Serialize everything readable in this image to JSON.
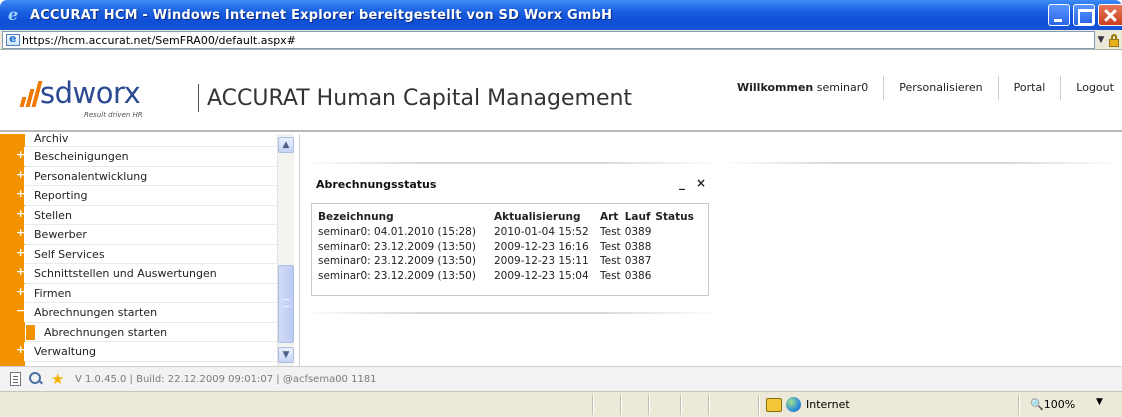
{
  "window": {
    "title": "ACCURAT HCM - Windows Internet Explorer bereitgestellt von SD Worx GmbH"
  },
  "address": {
    "url": "https://hcm.accurat.net/SemFRA00/default.aspx#"
  },
  "header": {
    "logo_word": "sdworx",
    "logo_tagline": "Result driven HR",
    "app_title": "ACCURAT Human Capital Management",
    "welcome_label": "Willkommen",
    "welcome_user": "seminar0",
    "nav": [
      "Personalisieren",
      "Portal",
      "Logout"
    ]
  },
  "sidebar": {
    "items": [
      {
        "label": "Archiv",
        "toggle": "+"
      },
      {
        "label": "Bescheinigungen",
        "toggle": "+"
      },
      {
        "label": "Personalentwicklung",
        "toggle": "+"
      },
      {
        "label": "Reporting",
        "toggle": "+"
      },
      {
        "label": "Stellen",
        "toggle": "+"
      },
      {
        "label": "Bewerber",
        "toggle": "+"
      },
      {
        "label": "Self Services",
        "toggle": "+"
      },
      {
        "label": "Schnittstellen und Auswertungen",
        "toggle": "+"
      },
      {
        "label": "Firmen",
        "toggle": "+"
      },
      {
        "label": "Abrechnungen starten",
        "toggle": "−"
      },
      {
        "label": "Abrechnungen starten",
        "toggle": ""
      },
      {
        "label": "Verwaltung",
        "toggle": "+"
      }
    ]
  },
  "widget": {
    "title": "Abrechnungsstatus",
    "minimize": "_",
    "close": "×",
    "columns": [
      "Bezeichnung",
      "Aktualisierung",
      "Art",
      "Lauf",
      "Status"
    ],
    "rows": [
      [
        "seminar0: 04.01.2010 (15:28)",
        "2010-01-04 15:52",
        "Test",
        "0389",
        ""
      ],
      [
        "seminar0: 23.12.2009 (13:50)",
        "2009-12-23 16:16",
        "Test",
        "0388",
        ""
      ],
      [
        "seminar0: 23.12.2009 (13:50)",
        "2009-12-23 15:11",
        "Test",
        "0387",
        ""
      ],
      [
        "seminar0: 23.12.2009 (13:50)",
        "2009-12-23 15:04",
        "Test",
        "0386",
        ""
      ]
    ]
  },
  "footer": {
    "version_text": "V 1.0.45.0 | Build: 22.12.2009 09:01:07 | @acfsema00 1181"
  },
  "status_bar": {
    "zone": "Internet",
    "zoom": "🔍100%"
  },
  "colors": {
    "accent": "#f39200",
    "brand_blue": "#2b4a92",
    "titlebar": "#1a5fe0"
  }
}
